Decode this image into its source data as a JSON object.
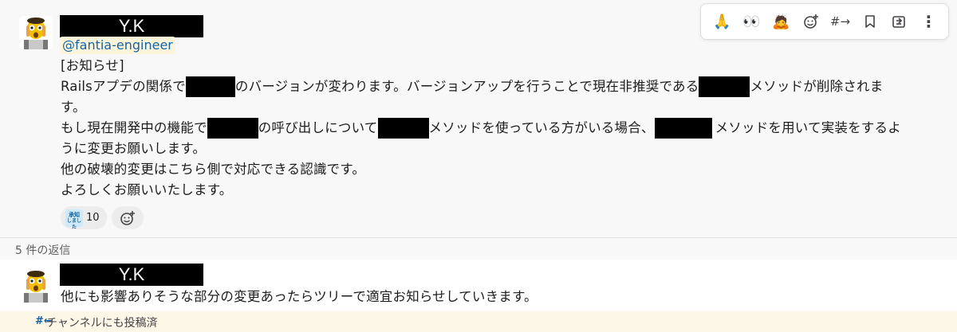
{
  "message": {
    "author": "Y.K",
    "mention": "@fantia-engineer",
    "lines": {
      "l1": "[お知らせ]",
      "l2a": "Railsアプデの関係で",
      "l2b": "のバージョンが変わります。バージョンアップを行うことで現在非推奨である",
      "l2c": "メソッドが削除されま",
      "l3": "す。",
      "l4a": "もし現在開発中の機能で",
      "l4b": "の呼び出しについて",
      "l4c": "メソッドを使っている方がいる場合、",
      "l4d": "メソッドを用いて実装をするよ",
      "l5": "うに変更お願いします。",
      "l6": "他の破壊的変更はこちら側で対応できる認識です。",
      "l7": "よろしくお願いいたします。"
    },
    "reaction": {
      "emoji_label_1": "承知",
      "emoji_label_2": "しました",
      "count": "10"
    }
  },
  "toolbar": {
    "icons": [
      "folded-hands-emoji",
      "eyes-emoji",
      "bowing-emoji",
      "add-reaction-icon",
      "forward-icon",
      "bookmark-icon",
      "share-icon",
      "more-icon"
    ],
    "glyphs": {
      "pray": "🙏",
      "eyes": "👀",
      "bow": "🙇",
      "forward": "#→",
      "more": "⋮"
    }
  },
  "thread": {
    "replies_label": "5 件の返信",
    "reply": {
      "author": "Y.K",
      "text": "他にも影響ありそうな部分の変更あったらツリーで適宜お知らせしていきます。"
    },
    "footer_icon": "#←",
    "footer_text": "チャンネルにも投稿済"
  },
  "colors": {
    "link": "#1264a3",
    "mention_bg": "#fdf4dc",
    "footer_bg": "#fdf7e8"
  }
}
